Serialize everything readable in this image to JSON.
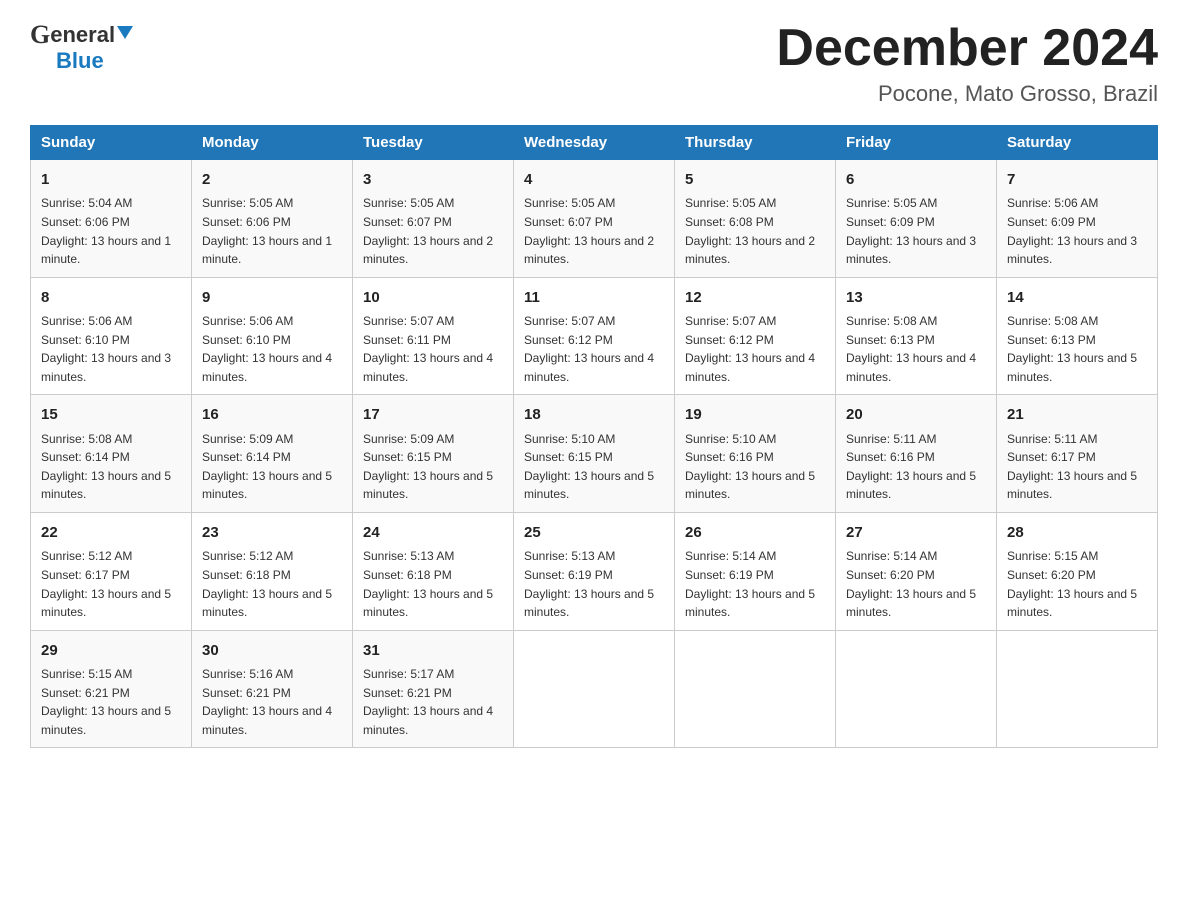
{
  "header": {
    "logo_general": "General",
    "logo_blue": "Blue",
    "month_title": "December 2024",
    "location": "Pocone, Mato Grosso, Brazil"
  },
  "days_of_week": [
    "Sunday",
    "Monday",
    "Tuesday",
    "Wednesday",
    "Thursday",
    "Friday",
    "Saturday"
  ],
  "weeks": [
    [
      {
        "day": "1",
        "sunrise": "Sunrise: 5:04 AM",
        "sunset": "Sunset: 6:06 PM",
        "daylight": "Daylight: 13 hours and 1 minute."
      },
      {
        "day": "2",
        "sunrise": "Sunrise: 5:05 AM",
        "sunset": "Sunset: 6:06 PM",
        "daylight": "Daylight: 13 hours and 1 minute."
      },
      {
        "day": "3",
        "sunrise": "Sunrise: 5:05 AM",
        "sunset": "Sunset: 6:07 PM",
        "daylight": "Daylight: 13 hours and 2 minutes."
      },
      {
        "day": "4",
        "sunrise": "Sunrise: 5:05 AM",
        "sunset": "Sunset: 6:07 PM",
        "daylight": "Daylight: 13 hours and 2 minutes."
      },
      {
        "day": "5",
        "sunrise": "Sunrise: 5:05 AM",
        "sunset": "Sunset: 6:08 PM",
        "daylight": "Daylight: 13 hours and 2 minutes."
      },
      {
        "day": "6",
        "sunrise": "Sunrise: 5:05 AM",
        "sunset": "Sunset: 6:09 PM",
        "daylight": "Daylight: 13 hours and 3 minutes."
      },
      {
        "day": "7",
        "sunrise": "Sunrise: 5:06 AM",
        "sunset": "Sunset: 6:09 PM",
        "daylight": "Daylight: 13 hours and 3 minutes."
      }
    ],
    [
      {
        "day": "8",
        "sunrise": "Sunrise: 5:06 AM",
        "sunset": "Sunset: 6:10 PM",
        "daylight": "Daylight: 13 hours and 3 minutes."
      },
      {
        "day": "9",
        "sunrise": "Sunrise: 5:06 AM",
        "sunset": "Sunset: 6:10 PM",
        "daylight": "Daylight: 13 hours and 4 minutes."
      },
      {
        "day": "10",
        "sunrise": "Sunrise: 5:07 AM",
        "sunset": "Sunset: 6:11 PM",
        "daylight": "Daylight: 13 hours and 4 minutes."
      },
      {
        "day": "11",
        "sunrise": "Sunrise: 5:07 AM",
        "sunset": "Sunset: 6:12 PM",
        "daylight": "Daylight: 13 hours and 4 minutes."
      },
      {
        "day": "12",
        "sunrise": "Sunrise: 5:07 AM",
        "sunset": "Sunset: 6:12 PM",
        "daylight": "Daylight: 13 hours and 4 minutes."
      },
      {
        "day": "13",
        "sunrise": "Sunrise: 5:08 AM",
        "sunset": "Sunset: 6:13 PM",
        "daylight": "Daylight: 13 hours and 4 minutes."
      },
      {
        "day": "14",
        "sunrise": "Sunrise: 5:08 AM",
        "sunset": "Sunset: 6:13 PM",
        "daylight": "Daylight: 13 hours and 5 minutes."
      }
    ],
    [
      {
        "day": "15",
        "sunrise": "Sunrise: 5:08 AM",
        "sunset": "Sunset: 6:14 PM",
        "daylight": "Daylight: 13 hours and 5 minutes."
      },
      {
        "day": "16",
        "sunrise": "Sunrise: 5:09 AM",
        "sunset": "Sunset: 6:14 PM",
        "daylight": "Daylight: 13 hours and 5 minutes."
      },
      {
        "day": "17",
        "sunrise": "Sunrise: 5:09 AM",
        "sunset": "Sunset: 6:15 PM",
        "daylight": "Daylight: 13 hours and 5 minutes."
      },
      {
        "day": "18",
        "sunrise": "Sunrise: 5:10 AM",
        "sunset": "Sunset: 6:15 PM",
        "daylight": "Daylight: 13 hours and 5 minutes."
      },
      {
        "day": "19",
        "sunrise": "Sunrise: 5:10 AM",
        "sunset": "Sunset: 6:16 PM",
        "daylight": "Daylight: 13 hours and 5 minutes."
      },
      {
        "day": "20",
        "sunrise": "Sunrise: 5:11 AM",
        "sunset": "Sunset: 6:16 PM",
        "daylight": "Daylight: 13 hours and 5 minutes."
      },
      {
        "day": "21",
        "sunrise": "Sunrise: 5:11 AM",
        "sunset": "Sunset: 6:17 PM",
        "daylight": "Daylight: 13 hours and 5 minutes."
      }
    ],
    [
      {
        "day": "22",
        "sunrise": "Sunrise: 5:12 AM",
        "sunset": "Sunset: 6:17 PM",
        "daylight": "Daylight: 13 hours and 5 minutes."
      },
      {
        "day": "23",
        "sunrise": "Sunrise: 5:12 AM",
        "sunset": "Sunset: 6:18 PM",
        "daylight": "Daylight: 13 hours and 5 minutes."
      },
      {
        "day": "24",
        "sunrise": "Sunrise: 5:13 AM",
        "sunset": "Sunset: 6:18 PM",
        "daylight": "Daylight: 13 hours and 5 minutes."
      },
      {
        "day": "25",
        "sunrise": "Sunrise: 5:13 AM",
        "sunset": "Sunset: 6:19 PM",
        "daylight": "Daylight: 13 hours and 5 minutes."
      },
      {
        "day": "26",
        "sunrise": "Sunrise: 5:14 AM",
        "sunset": "Sunset: 6:19 PM",
        "daylight": "Daylight: 13 hours and 5 minutes."
      },
      {
        "day": "27",
        "sunrise": "Sunrise: 5:14 AM",
        "sunset": "Sunset: 6:20 PM",
        "daylight": "Daylight: 13 hours and 5 minutes."
      },
      {
        "day": "28",
        "sunrise": "Sunrise: 5:15 AM",
        "sunset": "Sunset: 6:20 PM",
        "daylight": "Daylight: 13 hours and 5 minutes."
      }
    ],
    [
      {
        "day": "29",
        "sunrise": "Sunrise: 5:15 AM",
        "sunset": "Sunset: 6:21 PM",
        "daylight": "Daylight: 13 hours and 5 minutes."
      },
      {
        "day": "30",
        "sunrise": "Sunrise: 5:16 AM",
        "sunset": "Sunset: 6:21 PM",
        "daylight": "Daylight: 13 hours and 4 minutes."
      },
      {
        "day": "31",
        "sunrise": "Sunrise: 5:17 AM",
        "sunset": "Sunset: 6:21 PM",
        "daylight": "Daylight: 13 hours and 4 minutes."
      },
      null,
      null,
      null,
      null
    ]
  ]
}
